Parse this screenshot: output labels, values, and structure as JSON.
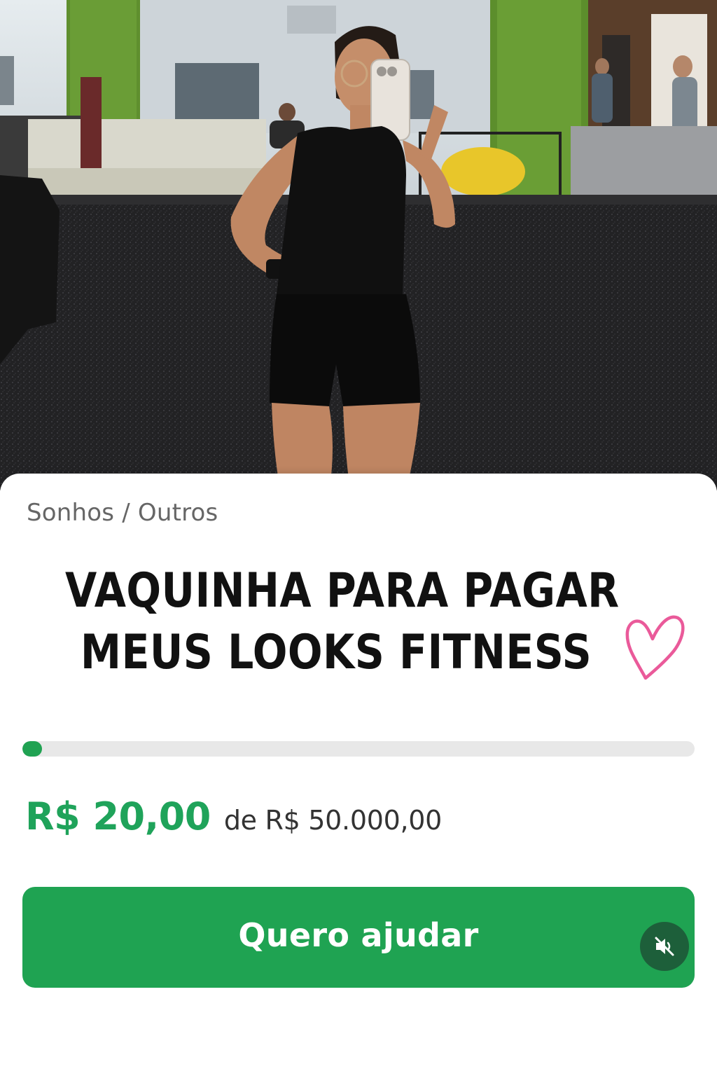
{
  "hero": {
    "image_alt": "Mirror selfie of a woman in black fitness outfit at a gym"
  },
  "campaign": {
    "breadcrumb": "Sonhos / Outros",
    "title_line1": "VAQUINHA PARA PAGAR",
    "title_line2": "MEUS LOOKS FITNESS",
    "title_icon": "heart-outline-icon",
    "raised": "R$ 20,00",
    "goal": "de R$ 50.000,00",
    "progress_fraction": 0.0004
  },
  "cta": {
    "label": "Quero ajudar",
    "mute_icon": "speaker-muted-icon"
  },
  "colors": {
    "accent": "#1fa352",
    "raised_text": "#1fa35a",
    "mute_bg": "#1d5f3a",
    "heart": "#ea5a9a",
    "track": "#e8e8e8"
  }
}
